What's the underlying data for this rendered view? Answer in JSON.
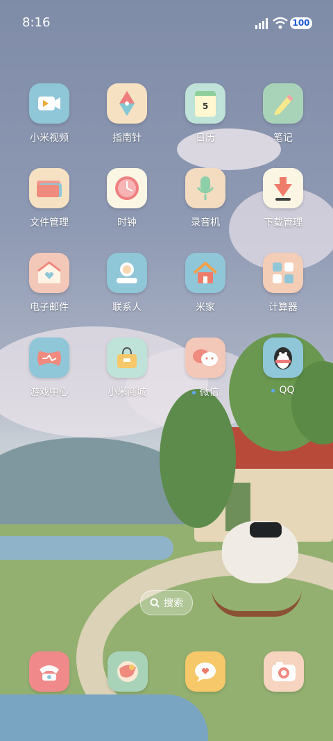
{
  "status_bar": {
    "time": "8:16",
    "battery": "100"
  },
  "apps": [
    {
      "label": "小米视频",
      "icon": "video-icon"
    },
    {
      "label": "指南针",
      "icon": "compass-icon"
    },
    {
      "label": "日历",
      "icon": "calendar-icon",
      "day": "5"
    },
    {
      "label": "笔记",
      "icon": "note-icon"
    },
    {
      "label": "文件管理",
      "icon": "folder-icon"
    },
    {
      "label": "时钟",
      "icon": "clock-icon"
    },
    {
      "label": "录音机",
      "icon": "recorder-icon"
    },
    {
      "label": "下载管理",
      "icon": "download-icon"
    },
    {
      "label": "电子邮件",
      "icon": "mail-icon"
    },
    {
      "label": "联系人",
      "icon": "contacts-icon"
    },
    {
      "label": "米家",
      "icon": "home-icon"
    },
    {
      "label": "计算器",
      "icon": "calculator-icon"
    },
    {
      "label": "游戏中心",
      "icon": "gamepad-icon"
    },
    {
      "label": "小米商城",
      "icon": "shopping-bag-icon"
    },
    {
      "label": "微信",
      "icon": "wechat-icon"
    },
    {
      "label": "QQ",
      "icon": "qq-icon"
    }
  ],
  "search": {
    "label": "搜索"
  },
  "dock": [
    {
      "icon": "phone-icon"
    },
    {
      "icon": "browser-icon"
    },
    {
      "icon": "messages-icon"
    },
    {
      "icon": "camera-icon"
    }
  ],
  "colors": {
    "icon_blue": "#8fc6d8",
    "icon_cream": "#f6e2c2",
    "icon_mint": "#bfe3d8",
    "icon_green": "#a9d3b9",
    "icon_pink": "#f4c8b8",
    "icon_red": "#f08a8a"
  }
}
